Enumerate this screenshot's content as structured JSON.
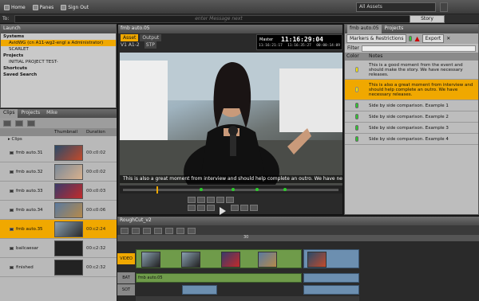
{
  "toolbar": {
    "home": "Home",
    "panes": "Panes",
    "sign_out": "Sign Out",
    "msg_label": "To:",
    "msg_placeholder": "enter Message  next",
    "assets_select": "All Assets",
    "story_btn": "Story"
  },
  "launch": {
    "tab": "Launch",
    "items": [
      "Systems",
      "AvidWG (cn A11-wg2-engl a Administrator)",
      "SCARLET",
      "Projects",
      "INITIAL PROJECT TEST-",
      "Shortcuts",
      "Saved Search"
    ]
  },
  "clips_panel": {
    "tabs": [
      "Clips",
      "Projects",
      "Mike"
    ],
    "col_thumb": "Thumbnail",
    "col_dur": "Duration",
    "folder": "Clips",
    "rows": [
      {
        "name": "fmb auto.31",
        "dur": "00:c0:02"
      },
      {
        "name": "fmb auto.32",
        "dur": "00:c0:02"
      },
      {
        "name": "fmb auto.33",
        "dur": "00:c0:03"
      },
      {
        "name": "fmb auto.34",
        "dur": "00:c0:06"
      },
      {
        "name": "fmb auto.35",
        "dur": "00:c2:24"
      },
      {
        "name": "bailcaesar",
        "dur": "00:c2:32"
      },
      {
        "name": "finished",
        "dur": "00:c2:32"
      }
    ]
  },
  "viewer": {
    "tab": "fmb auto.05",
    "asset_tab": "Asset",
    "output_tab": "Output",
    "track_info": "V1 A1-2",
    "stp": "STP",
    "tc_label": "Master",
    "tc_main": "11:16:29:04",
    "tc_in": "11:16:21:17",
    "tc_out": "11:16:35:27",
    "tc_dur": "00:00:14:09",
    "subtitle": "This is also a great moment from interview and should help complete an outro. We have nec..."
  },
  "markers": {
    "tab": "fmb auto.05",
    "tab2": "Projects",
    "dropdown": "Markers & Restrictions",
    "export": "Export",
    "filter_label": "Filter",
    "col_color": "Color",
    "col_notes": "Notes",
    "rows": [
      {
        "note": "This is a good moment from the event and should make the story. We have necessary releases.",
        "color": "yellow"
      },
      {
        "note": "This is also a great moment from interview and should help complete an outro. We have necessary releases.",
        "color": "yellow"
      },
      {
        "note": "Side by side comparison. Example 1",
        "color": "green"
      },
      {
        "note": "Side by side comparison. Example 2",
        "color": "green"
      },
      {
        "note": "Side by side comparison. Example 3",
        "color": "green"
      },
      {
        "note": "Side by side comparison. Example 4",
        "color": "green"
      }
    ]
  },
  "sequence": {
    "tab": "RoughCut_v2",
    "ruler_30": "30",
    "tracks": [
      "VIDEO",
      "BAT",
      "SOT"
    ],
    "audio_clip": "fmb auto.05"
  }
}
